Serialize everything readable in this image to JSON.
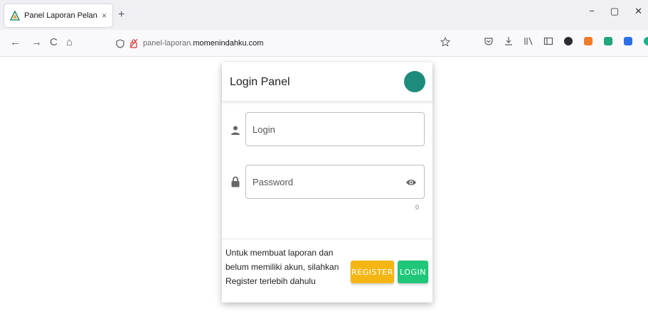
{
  "tab": {
    "title": "Panel Laporan Pelanggaran",
    "close": "×",
    "new": "+"
  },
  "window_controls": {
    "minimize": "−",
    "restore": "▢",
    "close": "✕"
  },
  "nav": {
    "back": "←",
    "forward": "→",
    "reload": "C",
    "home": "⌂"
  },
  "url": {
    "prefix": "panel-laporan.",
    "domain": "momenindahku.com"
  },
  "login": {
    "title": "Login Panel",
    "username_placeholder": "Login",
    "password_placeholder": "Password",
    "password_counter": "0",
    "note": "Untuk membuat laporan dan belum memiliki akun, silahkan Register terlebih dahulu",
    "register_label": "REGISTER",
    "login_label": "LOGIN"
  },
  "colors": {
    "accent_teal": "#1e8c7c",
    "register": "#f5b614",
    "login": "#20c77a"
  },
  "icons": [
    "person-icon",
    "lock-icon",
    "eye-icon",
    "moon-icon",
    "shield-icon",
    "star-icon"
  ]
}
